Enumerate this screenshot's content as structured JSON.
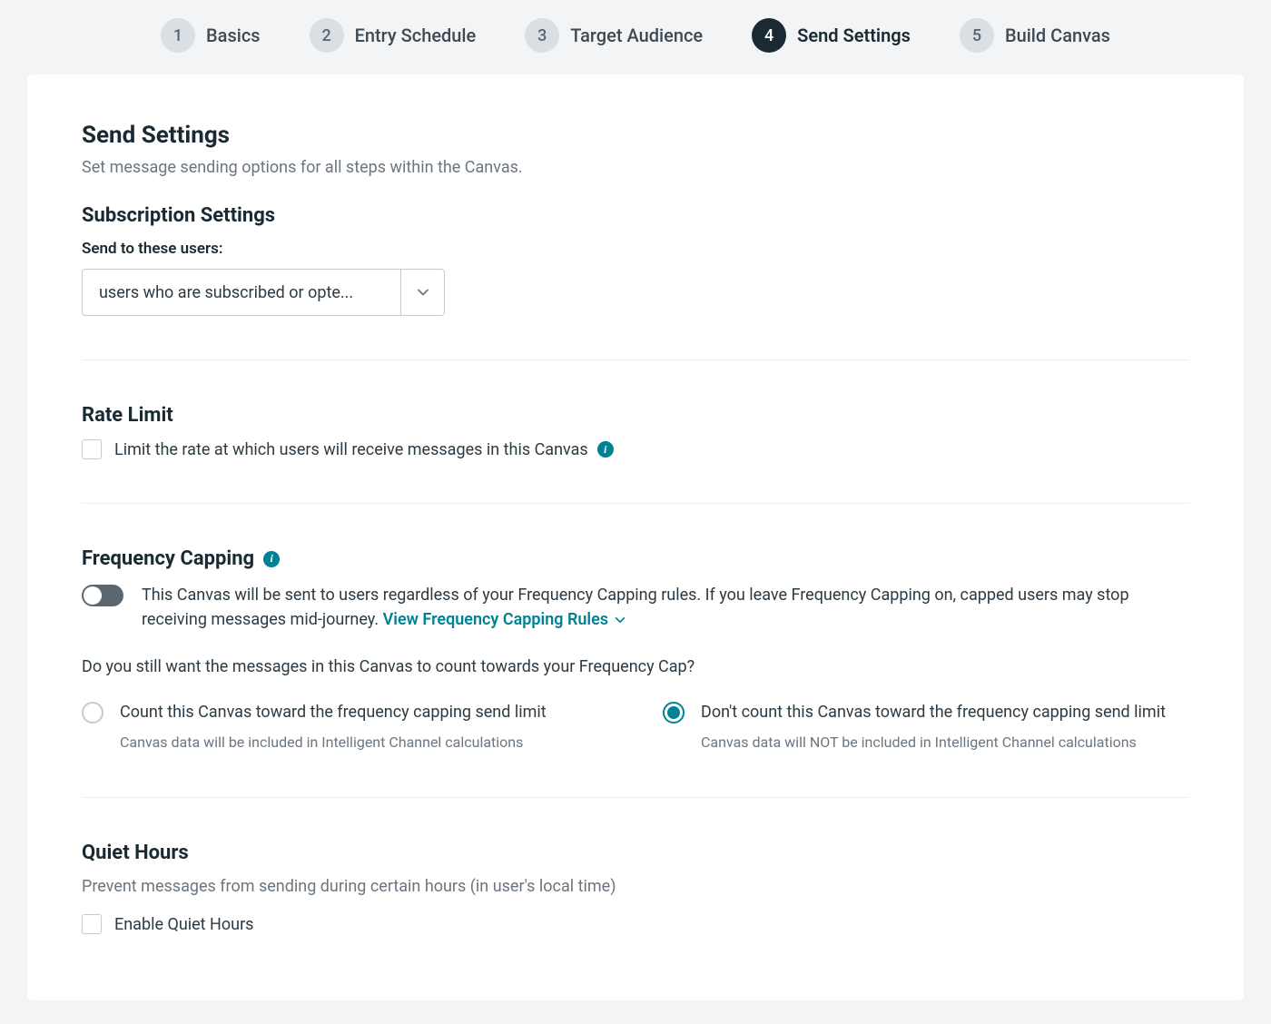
{
  "stepper": {
    "steps": [
      {
        "num": "1",
        "label": "Basics",
        "active": false
      },
      {
        "num": "2",
        "label": "Entry Schedule",
        "active": false
      },
      {
        "num": "3",
        "label": "Target Audience",
        "active": false
      },
      {
        "num": "4",
        "label": "Send Settings",
        "active": true
      },
      {
        "num": "5",
        "label": "Build Canvas",
        "active": false
      }
    ]
  },
  "page": {
    "title": "Send Settings",
    "subtitle": "Set message sending options for all steps within the Canvas."
  },
  "subscription": {
    "heading": "Subscription Settings",
    "field_label": "Send to these users:",
    "select_value": "users who are subscribed or opte..."
  },
  "rate_limit": {
    "heading": "Rate Limit",
    "checkbox_label": "Limit the rate at which users will receive messages in this Canvas"
  },
  "frequency": {
    "heading": "Frequency Capping",
    "toggle_text": "This Canvas will be sent to users regardless of your Frequency Capping rules. If you leave Frequency Capping on, capped users may stop receiving messages mid-journey. ",
    "link": "View Frequency Capping Rules",
    "question": "Do you still want the messages in this Canvas to count towards your Frequency Cap?",
    "options": [
      {
        "label": "Count this Canvas toward the frequency capping send limit",
        "help": "Canvas data will be included in Intelligent Channel calculations",
        "selected": false
      },
      {
        "label": "Don't count this Canvas toward the frequency capping send limit",
        "help": "Canvas data will NOT be included in Intelligent Channel calculations",
        "selected": true
      }
    ]
  },
  "quiet_hours": {
    "heading": "Quiet Hours",
    "subtitle": "Prevent messages from sending during certain hours (in user's local time)",
    "checkbox_label": "Enable Quiet Hours"
  }
}
